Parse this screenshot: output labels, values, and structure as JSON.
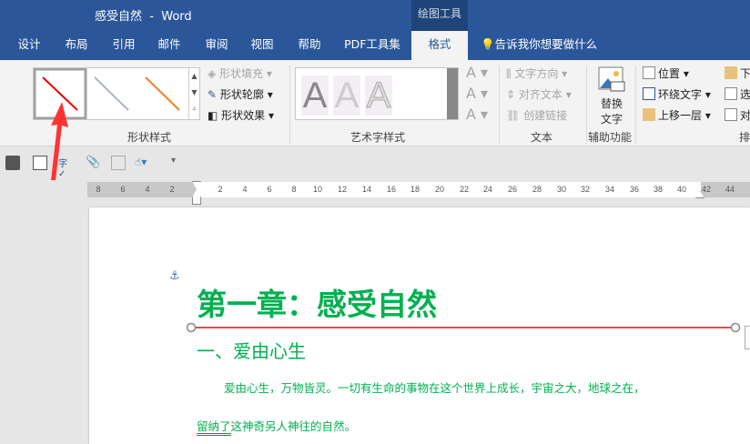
{
  "window": {
    "title": "感受自然  -  Word",
    "context_tab": "绘图工具"
  },
  "tabs": [
    "设计",
    "布局",
    "引用",
    "邮件",
    "审阅",
    "视图",
    "帮助",
    "PDF工具集",
    "格式"
  ],
  "active_tab": "格式",
  "tell_me": "告诉我你想要做什么",
  "ribbon": {
    "shape_styles": {
      "label": "形状样式",
      "fill": "形状填充",
      "outline": "形状轮廓",
      "effect": "形状效果"
    },
    "wordart": {
      "label": "艺术字样式",
      "sample": "A"
    },
    "text": {
      "label": "文本",
      "direction": "文字方向",
      "align": "对齐文本",
      "link": "创建链接"
    },
    "accessibility": {
      "label": "辅助功能",
      "alt_text_1": "替换",
      "alt_text_2": "文字"
    },
    "arrange": {
      "label": "排",
      "position": "位置",
      "wrap": "环绕文字",
      "forward": "上移一层",
      "backward": "下",
      "select": "选",
      "align": "对"
    }
  },
  "ruler": [
    "8",
    "6",
    "4",
    "2",
    "2",
    "4",
    "6",
    "8",
    "10",
    "12",
    "14",
    "16",
    "18",
    "20",
    "22",
    "24",
    "26",
    "28",
    "30",
    "32",
    "34",
    "36",
    "38",
    "40",
    "42",
    "44"
  ],
  "document": {
    "heading": "第一章：感受自然",
    "subheading": "一、爱由心生",
    "para1": "爱由心生，万物皆灵。一切有生命的事物在这个世界上成长，宇宙之大，地球之在，",
    "para2_underlined": "留纳了",
    "para2_rest": "这神奇另人神往的自然。"
  },
  "colors": {
    "brand": "#2b579a",
    "text_green": "#00b050",
    "line_red": "#ff0000",
    "arrow": "#ff3333"
  }
}
